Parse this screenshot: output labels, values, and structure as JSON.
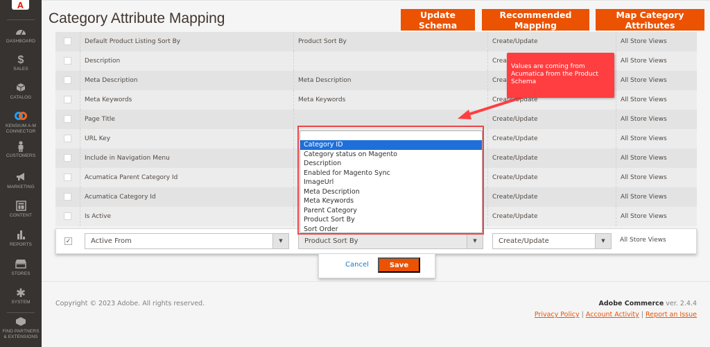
{
  "sidebar": {
    "logo": "A",
    "items": [
      {
        "label": "Dashboard",
        "icon": "dashboard-icon",
        "glyph": "◠"
      },
      {
        "label": "Sales",
        "icon": "dollar-icon",
        "glyph": "$"
      },
      {
        "label": "Catalog",
        "icon": "box-icon",
        "glyph": "◆"
      },
      {
        "label": "Kensium A-M Connector",
        "label_line1": "Kensium A-M",
        "label_line2": "Connector",
        "icon": "connector-icon",
        "glyph": "∞"
      },
      {
        "label": "Customers",
        "icon": "person-icon",
        "glyph": "♟"
      },
      {
        "label": "Marketing",
        "icon": "megaphone-icon",
        "glyph": "◀"
      },
      {
        "label": "Content",
        "icon": "layout-icon",
        "glyph": "▣"
      },
      {
        "label": "Reports",
        "icon": "bar-chart-icon",
        "glyph": "▮"
      },
      {
        "label": "Stores",
        "icon": "storefront-icon",
        "glyph": "▦"
      },
      {
        "label": "System",
        "icon": "gear-icon",
        "glyph": "✱"
      },
      {
        "label": "Find Partners & Extensions",
        "label_line1": "Find Partners",
        "label_line2": "& Extensions",
        "icon": "blocks-icon",
        "glyph": "⬢"
      }
    ]
  },
  "header": {
    "title": "Category Attribute Mapping",
    "buttons": {
      "update_schema": "Update Schema",
      "recommended_mapping": "Recommended Mapping",
      "map_category_attributes": "Map Category Attributes"
    },
    "accent_color": "#eb5202"
  },
  "table": {
    "rows": [
      {
        "magento": "Default Product Listing Sort By",
        "acumatica": "Product Sort By",
        "direction": "Create/Update",
        "store": "All Store Views",
        "checked": false
      },
      {
        "magento": "Description",
        "acumatica": "",
        "direction": "Create/Update",
        "store": "All Store Views",
        "checked": false
      },
      {
        "magento": "Meta Description",
        "acumatica": "Meta Description",
        "direction": "Create/Update",
        "store": "All Store Views",
        "checked": false
      },
      {
        "magento": "Meta Keywords",
        "acumatica": "Meta Keywords",
        "direction": "Create/Update",
        "store": "All Store Views",
        "checked": false
      },
      {
        "magento": "Page Title",
        "acumatica": "",
        "direction": "Create/Update",
        "store": "All Store Views",
        "checked": false
      },
      {
        "magento": "URL Key",
        "acumatica": "",
        "direction": "Create/Update",
        "store": "All Store Views",
        "checked": false
      },
      {
        "magento": "Include in Navigation Menu",
        "acumatica": "",
        "direction": "Create/Update",
        "store": "All Store Views",
        "checked": false
      },
      {
        "magento": "Acumatica Parent Category Id",
        "acumatica": "",
        "direction": "Create/Update",
        "store": "All Store Views",
        "checked": false
      },
      {
        "magento": "Acumatica Category Id",
        "acumatica": "",
        "direction": "Create/Update",
        "store": "All Store Views",
        "checked": false
      },
      {
        "magento": "Is Active",
        "acumatica": "",
        "direction": "Create/Update",
        "store": "All Store Views",
        "checked": false
      }
    ],
    "edit_row": {
      "checked": true,
      "check_glyph": "✓",
      "magento_select": "Active From",
      "acumatica_select": "Product Sort By",
      "direction_select": "Create/Update",
      "store": "All Store Views",
      "arrow_glyph": "▼"
    },
    "actions": {
      "cancel": "Cancel",
      "save": "Save"
    }
  },
  "dropdown": {
    "search_value": "",
    "options": [
      "Category ID",
      "Category status on Magento",
      "Description",
      "Enabled for Magento Sync",
      "ImageUrl",
      "Meta Description",
      "Meta Keywords",
      "Parent Category",
      "Product Sort By",
      "Sort Order"
    ],
    "highlighted": "Category ID"
  },
  "callout": {
    "text": "Values are coming from Acumatica from the Product Schema",
    "color": "#ff3e41"
  },
  "footer": {
    "copyright": "Copyright © 2023 Adobe. All rights reserved.",
    "product": "Adobe Commerce",
    "version": " ver. 2.4.4",
    "links": {
      "privacy": "Privacy Policy",
      "activity": "Account Activity",
      "report": "Report an Issue"
    },
    "separator": "|"
  }
}
